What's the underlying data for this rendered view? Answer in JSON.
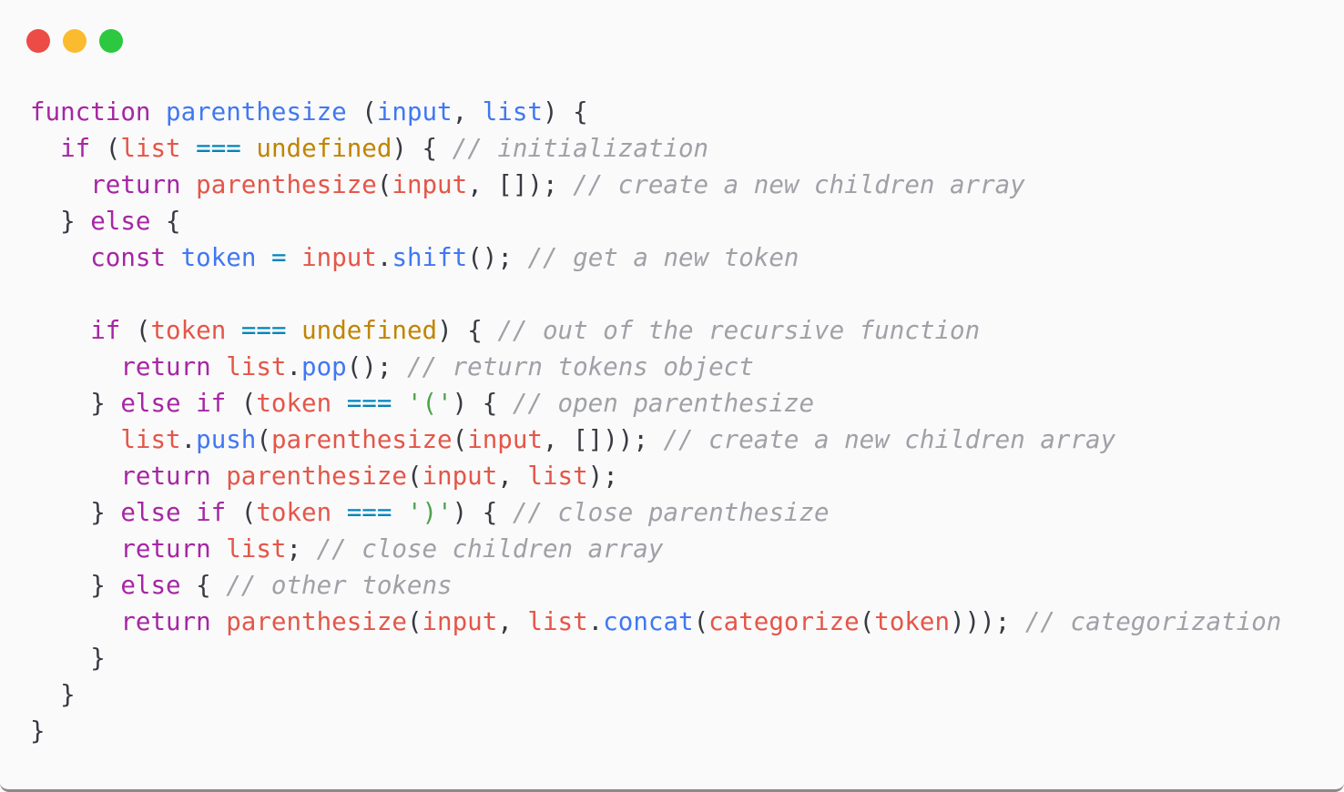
{
  "window": {
    "controls": {
      "close_color": "#ec4b46",
      "minimize_color": "#fbbb2e",
      "zoom_color": "#2bc840"
    }
  },
  "colors": {
    "keyword": "#a626a4",
    "function": "#4078f2",
    "variable": "#e45649",
    "constant": "#c18401",
    "operator": "#0184bc",
    "string": "#50a14f",
    "comment": "#a0a1a7",
    "punctuation": "#383a42"
  },
  "code": {
    "language": "javascript",
    "lines": [
      [
        [
          "keyword",
          "function"
        ],
        [
          "punctuation",
          " "
        ],
        [
          "function",
          "parenthesize"
        ],
        [
          "punctuation",
          " ("
        ],
        [
          "function",
          "input"
        ],
        [
          "punctuation",
          ", "
        ],
        [
          "function",
          "list"
        ],
        [
          "punctuation",
          ") {"
        ]
      ],
      [
        [
          "punctuation",
          "  "
        ],
        [
          "keyword",
          "if"
        ],
        [
          "punctuation",
          " ("
        ],
        [
          "variable",
          "list"
        ],
        [
          "punctuation",
          " "
        ],
        [
          "operator",
          "==="
        ],
        [
          "punctuation",
          " "
        ],
        [
          "constant",
          "undefined"
        ],
        [
          "punctuation",
          ") { "
        ],
        [
          "comment",
          "// initialization"
        ]
      ],
      [
        [
          "punctuation",
          "    "
        ],
        [
          "keyword",
          "return"
        ],
        [
          "punctuation",
          " "
        ],
        [
          "variable",
          "parenthesize"
        ],
        [
          "punctuation",
          "("
        ],
        [
          "variable",
          "input"
        ],
        [
          "punctuation",
          ", []); "
        ],
        [
          "comment",
          "// create a new children array"
        ]
      ],
      [
        [
          "punctuation",
          "  } "
        ],
        [
          "keyword",
          "else"
        ],
        [
          "punctuation",
          " {"
        ]
      ],
      [
        [
          "punctuation",
          "    "
        ],
        [
          "keyword",
          "const"
        ],
        [
          "punctuation",
          " "
        ],
        [
          "function",
          "token"
        ],
        [
          "punctuation",
          " "
        ],
        [
          "operator",
          "="
        ],
        [
          "punctuation",
          " "
        ],
        [
          "variable",
          "input"
        ],
        [
          "punctuation",
          "."
        ],
        [
          "function",
          "shift"
        ],
        [
          "punctuation",
          "(); "
        ],
        [
          "comment",
          "// get a new token"
        ]
      ],
      [],
      [
        [
          "punctuation",
          "    "
        ],
        [
          "keyword",
          "if"
        ],
        [
          "punctuation",
          " ("
        ],
        [
          "variable",
          "token"
        ],
        [
          "punctuation",
          " "
        ],
        [
          "operator",
          "==="
        ],
        [
          "punctuation",
          " "
        ],
        [
          "constant",
          "undefined"
        ],
        [
          "punctuation",
          ") { "
        ],
        [
          "comment",
          "// out of the recursive function"
        ]
      ],
      [
        [
          "punctuation",
          "      "
        ],
        [
          "keyword",
          "return"
        ],
        [
          "punctuation",
          " "
        ],
        [
          "variable",
          "list"
        ],
        [
          "punctuation",
          "."
        ],
        [
          "function",
          "pop"
        ],
        [
          "punctuation",
          "(); "
        ],
        [
          "comment",
          "// return tokens object"
        ]
      ],
      [
        [
          "punctuation",
          "    } "
        ],
        [
          "keyword",
          "else if"
        ],
        [
          "punctuation",
          " ("
        ],
        [
          "variable",
          "token"
        ],
        [
          "punctuation",
          " "
        ],
        [
          "operator",
          "==="
        ],
        [
          "punctuation",
          " "
        ],
        [
          "string",
          "'('"
        ],
        [
          "punctuation",
          ") { "
        ],
        [
          "comment",
          "// open parenthesize"
        ]
      ],
      [
        [
          "punctuation",
          "      "
        ],
        [
          "variable",
          "list"
        ],
        [
          "punctuation",
          "."
        ],
        [
          "function",
          "push"
        ],
        [
          "punctuation",
          "("
        ],
        [
          "variable",
          "parenthesize"
        ],
        [
          "punctuation",
          "("
        ],
        [
          "variable",
          "input"
        ],
        [
          "punctuation",
          ", [])); "
        ],
        [
          "comment",
          "// create a new children array"
        ]
      ],
      [
        [
          "punctuation",
          "      "
        ],
        [
          "keyword",
          "return"
        ],
        [
          "punctuation",
          " "
        ],
        [
          "variable",
          "parenthesize"
        ],
        [
          "punctuation",
          "("
        ],
        [
          "variable",
          "input"
        ],
        [
          "punctuation",
          ", "
        ],
        [
          "variable",
          "list"
        ],
        [
          "punctuation",
          ");"
        ]
      ],
      [
        [
          "punctuation",
          "    } "
        ],
        [
          "keyword",
          "else if"
        ],
        [
          "punctuation",
          " ("
        ],
        [
          "variable",
          "token"
        ],
        [
          "punctuation",
          " "
        ],
        [
          "operator",
          "==="
        ],
        [
          "punctuation",
          " "
        ],
        [
          "string",
          "')'"
        ],
        [
          "punctuation",
          ") { "
        ],
        [
          "comment",
          "// close parenthesize"
        ]
      ],
      [
        [
          "punctuation",
          "      "
        ],
        [
          "keyword",
          "return"
        ],
        [
          "punctuation",
          " "
        ],
        [
          "variable",
          "list"
        ],
        [
          "punctuation",
          "; "
        ],
        [
          "comment",
          "// close children array"
        ]
      ],
      [
        [
          "punctuation",
          "    } "
        ],
        [
          "keyword",
          "else"
        ],
        [
          "punctuation",
          " { "
        ],
        [
          "comment",
          "// other tokens"
        ]
      ],
      [
        [
          "punctuation",
          "      "
        ],
        [
          "keyword",
          "return"
        ],
        [
          "punctuation",
          " "
        ],
        [
          "variable",
          "parenthesize"
        ],
        [
          "punctuation",
          "("
        ],
        [
          "variable",
          "input"
        ],
        [
          "punctuation",
          ", "
        ],
        [
          "variable",
          "list"
        ],
        [
          "punctuation",
          "."
        ],
        [
          "function",
          "concat"
        ],
        [
          "punctuation",
          "("
        ],
        [
          "variable",
          "categorize"
        ],
        [
          "punctuation",
          "("
        ],
        [
          "variable",
          "token"
        ],
        [
          "punctuation",
          ")));"
        ],
        [
          "punctuation",
          " "
        ],
        [
          "comment",
          "// categorization"
        ]
      ],
      [
        [
          "punctuation",
          "    }"
        ]
      ],
      [
        [
          "punctuation",
          "  }"
        ]
      ],
      [
        [
          "punctuation",
          "}"
        ]
      ]
    ]
  }
}
